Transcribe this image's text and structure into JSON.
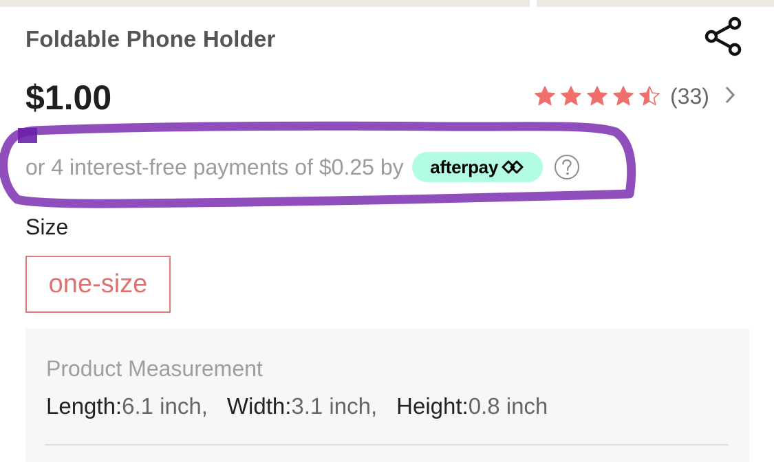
{
  "product": {
    "title": "Foldable Phone Holder",
    "price": "$1.00",
    "rating": {
      "value": 4.5,
      "max": 5,
      "count_text": "(33)",
      "star_color": "#ef6f6c"
    }
  },
  "icons": {
    "share": "share-icon",
    "star": "star-icon",
    "chevron": "chevron-right-icon",
    "help": "question-circle-icon",
    "afterpay_logo": "afterpay-arrows-icon"
  },
  "afterpay": {
    "text": "or 4 interest-free payments of $0.25 by",
    "badge_label": "afterpay",
    "badge_color": "#b2fce4",
    "highlight_color": "#7b2fb0"
  },
  "size": {
    "label": "Size",
    "options": [
      "one-size"
    ],
    "selected": "one-size",
    "accent_color": "#e0706e"
  },
  "measurement": {
    "title": "Product Measurement",
    "items": [
      {
        "label": "Length:",
        "value": "6.1 inch,"
      },
      {
        "label": "Width:",
        "value": "3.1 inch,"
      },
      {
        "label": "Height:",
        "value": "0.8 inch"
      }
    ]
  }
}
